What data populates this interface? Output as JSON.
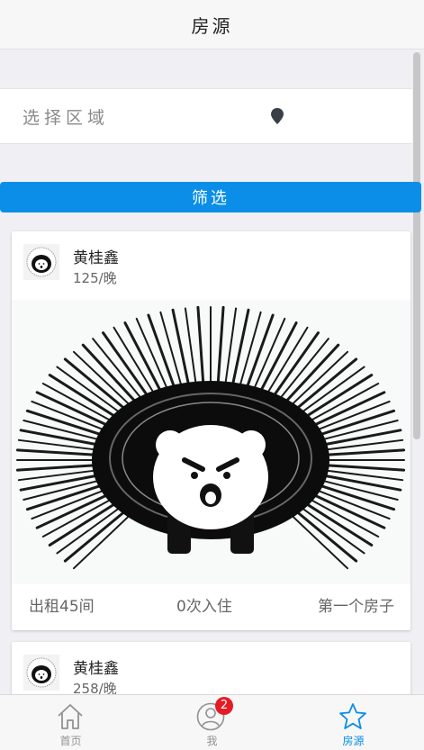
{
  "header": {
    "title": "房源"
  },
  "region": {
    "label": "选择区域",
    "pin_icon": "location-pin-icon"
  },
  "filter": {
    "label": "筛选"
  },
  "listings": [
    {
      "owner": "黄桂鑫",
      "price": "125/晚",
      "rooms": "出租45间",
      "checkins": "0次入住",
      "house_name": "第一个房子"
    },
    {
      "owner": "黄桂鑫",
      "price": "258/晚"
    }
  ],
  "tabbar": {
    "items": [
      {
        "label": "首页",
        "icon": "home-icon"
      },
      {
        "label": "我",
        "icon": "user-icon",
        "badge": "2"
      },
      {
        "label": "房源",
        "icon": "star-icon",
        "active": true
      }
    ]
  },
  "colors": {
    "accent": "#0a8ee8",
    "badge": "#e51c23"
  }
}
